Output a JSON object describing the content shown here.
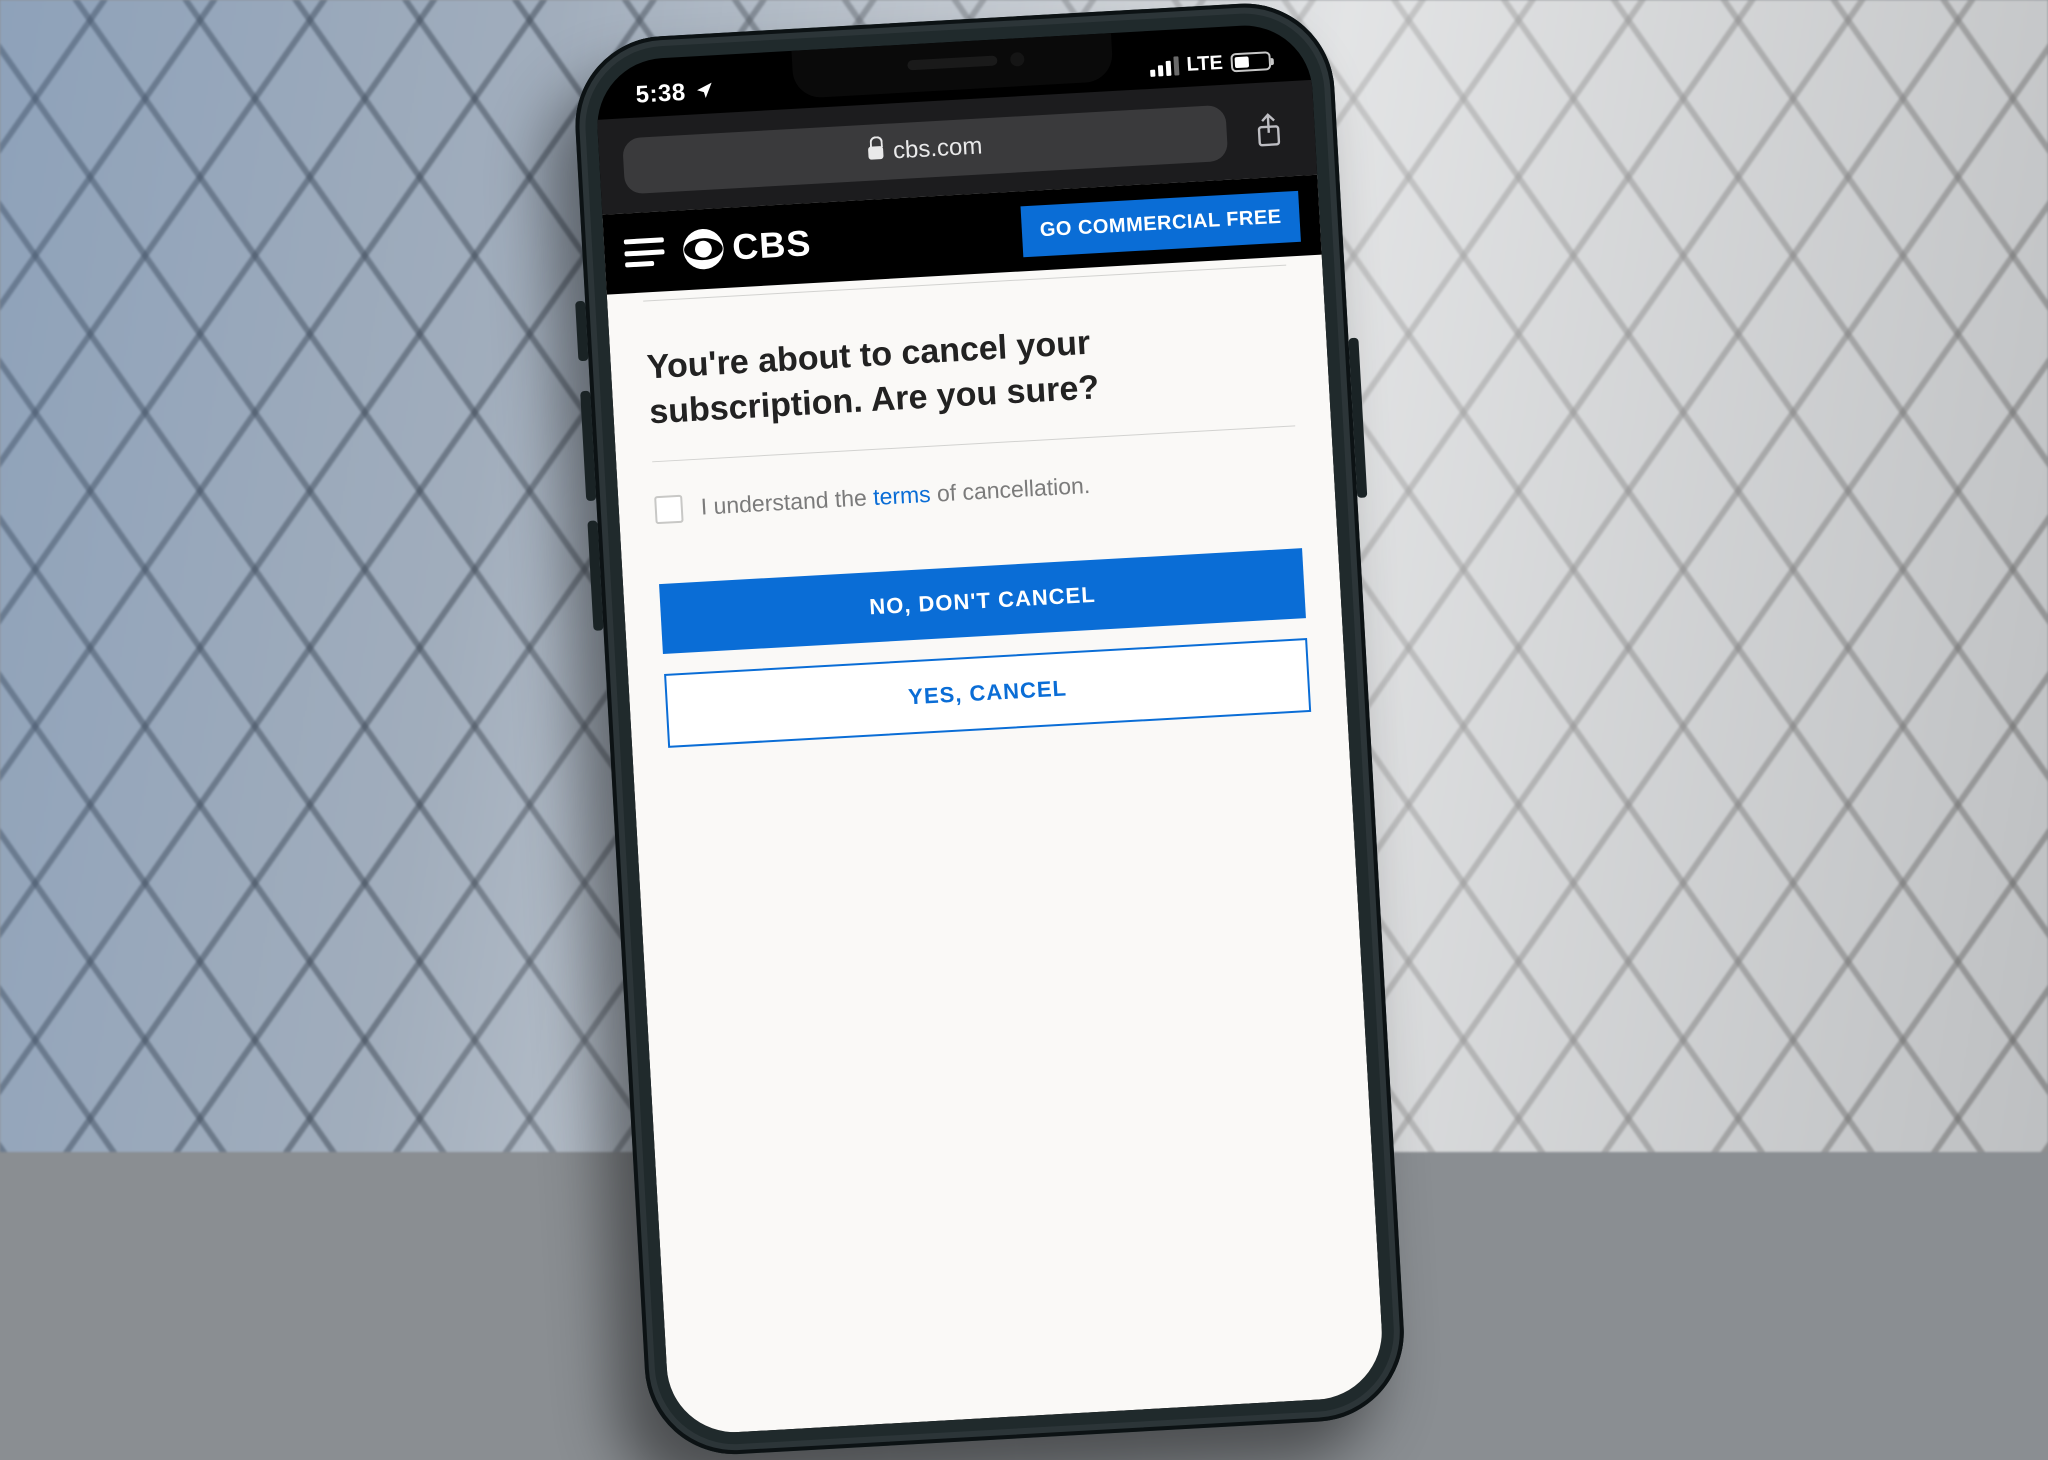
{
  "status_bar": {
    "time": "5:38",
    "network_label": "LTE"
  },
  "browser": {
    "url": "cbs.com"
  },
  "site_header": {
    "brand": "CBS",
    "promo_label": "GO COMMERCIAL FREE"
  },
  "dialog": {
    "headline": "You're about to cancel your subscription. Are you sure?",
    "consent_prefix": "I understand the ",
    "consent_link": "terms",
    "consent_suffix": " of cancellation.",
    "primary_button": "NO, DON'T CANCEL",
    "secondary_button": "YES, CANCEL"
  }
}
